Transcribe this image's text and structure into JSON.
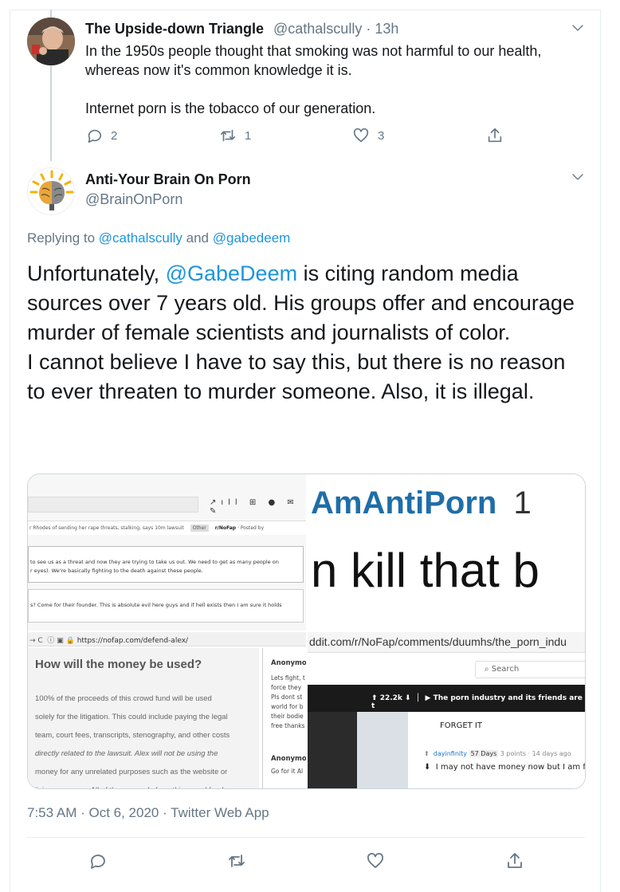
{
  "reply_tweet": {
    "author_name": "The Upside-down Triangle",
    "handle": "@cathalscully",
    "time": "· 13h",
    "lines": [
      "In the 1950s people thought that smoking was not harmful to our health,",
      "whereas now it's common knowledge it is.",
      "",
      "Internet porn is the tobacco of our generation."
    ],
    "reply_count": "2",
    "retweet_count": "1",
    "like_count": "3"
  },
  "main_tweet": {
    "author_name": "Anti-Your Brain On Porn",
    "handle": "@BrainOnPorn",
    "replying_prefix": "Replying to ",
    "replying_user1": "@cathalscully",
    "replying_and": " and ",
    "replying_user2": "@gabedeem",
    "text_part1": "Unfortunately, ",
    "text_mention": "@GabeDeem",
    "text_part2": " is citing random media sources over 7 years old. His groups offer and encourage murder of female scientists and journalists of color.",
    "text_part3": "I cannot believe I have to say this, but there is no reason to ever threaten to murder someone. Also, it is illegal.",
    "timestamp": "7:53 AM · Oct 6, 2020 · Twitter Web App"
  },
  "media": {
    "q1": {
      "post_meta": "r Rhodes of sending her rape threats, stalking, says 10m lawsuit",
      "tag": "Other",
      "sub": "r/NoFap",
      "posted_by": "· Posted by",
      "line1": "to see us as a threat and now they are trying to take us out. We need to get as many people on",
      "line2": "r eyes). We're basically fighting to the death against these people.",
      "line3": "s? Come for their founder. This is absolute evil here guys and if hell exists then I am sure it holds"
    },
    "q2": {
      "word": "AmAntiPorn",
      "num": "1",
      "big": "n kill that b"
    },
    "q3": {
      "url": "https://nofap.com/defend-alex/",
      "heading": "How will the money be used?",
      "para_lines": [
        "100% of the proceeds of this crowd fund will be used",
        "solely for the litigation. This could include paying the legal",
        "team, court fees, transcripts, stenography, and other costs",
        "directly related to the lawsuit. Alex will not be using the",
        "money for any unrelated purposes such as the website or",
        "living expenses. All of the proceeds from this crowd fund"
      ],
      "anon1": "Anonymo",
      "anon1_lines": [
        "Lets fight, t",
        "force they",
        "Pls dont st",
        "world for b",
        "their bodie",
        "free thanks"
      ],
      "anon2": "Anonymo",
      "anon2_line": "Go for it Al"
    },
    "q4": {
      "url": "ddit.com/r/NoFap/comments/duumhs/the_porn_indu",
      "search": "Search",
      "score": "22.2k",
      "post_title": "The porn industry and its friends are t",
      "forget": "FORGET IT",
      "commenter": "dayinfinity",
      "days_badge": "57 Days",
      "points": "3 points · 14 days ago",
      "comment": "I may not have money now but I am fig"
    }
  }
}
